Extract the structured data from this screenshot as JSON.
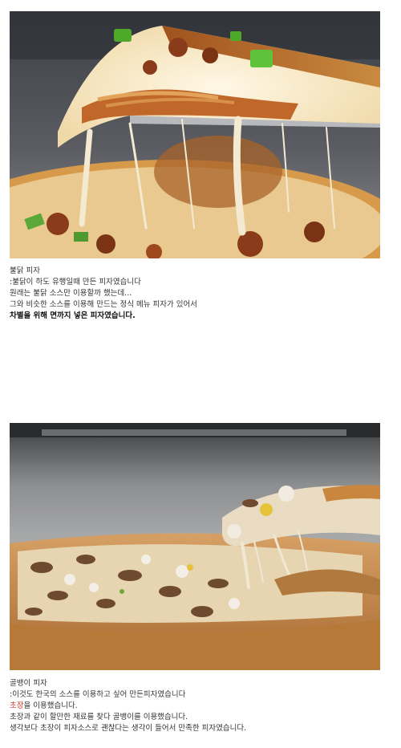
{
  "post1": {
    "title": "불닭 피자",
    "lines": [
      ":불닭이 하도 유행일때 만든 피자였습니다",
      "원래는 불닭 소스만 이용할까 했는데...",
      "그와 비슷한 소스를 이용해 만드는 정식 메뉴 피자가 있어서"
    ],
    "emphasis": "차별을 위해 면까지 넣은 피자였습니다."
  },
  "post2": {
    "title": "골뱅이 피자",
    "line1": ":이것도 한국의 소스를 이용하고 싶어 만든피자였습니다",
    "highlight": "초장",
    "line2_rest": "을 이용했습니다.",
    "line3": "초장과 같이 할만한 재료를 찾다 골뱅이를 이용했습니다.",
    "line4": "생각보다 초장이 피자소스로 괜찮다는 생각이 들어서 만족한 피자였습니다."
  },
  "colors": {
    "highlight": "#d4372c"
  },
  "images": [
    {
      "icon": "buldak-pizza-photo"
    },
    {
      "icon": "golbaengi-pizza-photo"
    }
  ]
}
